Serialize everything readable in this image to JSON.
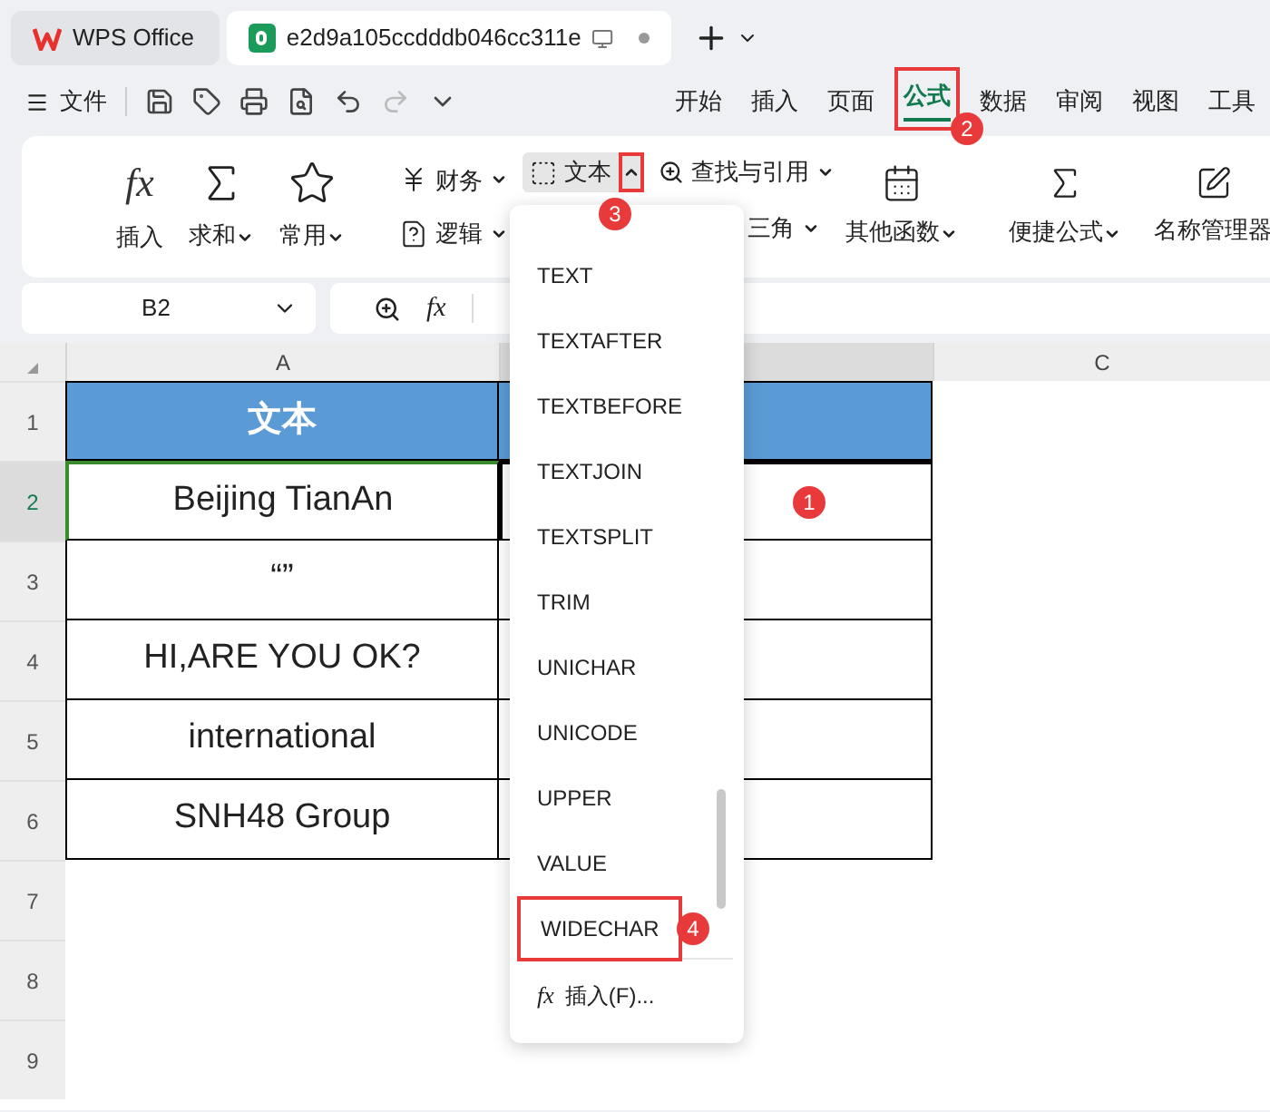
{
  "title_tabs": [
    {
      "label": "WPS Office",
      "kind": "home",
      "selected": false
    },
    {
      "label": "e2d9a105ccdddb046cc311e",
      "kind": "doc",
      "selected": true
    }
  ],
  "menu": {
    "file": "文件",
    "tabs": [
      {
        "label": "开始",
        "selected": false
      },
      {
        "label": "插入",
        "selected": false
      },
      {
        "label": "页面",
        "selected": false
      },
      {
        "label": "公式",
        "selected": true,
        "badge": "2"
      },
      {
        "label": "数据",
        "selected": false
      },
      {
        "label": "审阅",
        "selected": false
      },
      {
        "label": "视图",
        "selected": false
      },
      {
        "label": "工具",
        "selected": false
      }
    ]
  },
  "ribbon": {
    "big": [
      {
        "label": "插入",
        "glyph": "fx",
        "caret": false
      },
      {
        "label": "求和",
        "caret": true
      },
      {
        "label": "常用",
        "caret": true
      }
    ],
    "col1": [
      {
        "label": "财务",
        "selected": false
      },
      {
        "label": "逻辑",
        "selected": false
      }
    ],
    "text_button": {
      "label": "文本",
      "selected": true,
      "badge": "3"
    },
    "lookup": "查找与引用",
    "trig": "三角",
    "other": {
      "label": "其他函数"
    },
    "quick": {
      "label": "便捷公式"
    },
    "names": {
      "label": "名称管理器"
    }
  },
  "formula_bar": {
    "cell_ref": "B2",
    "glyph": "fx"
  },
  "sheet": {
    "columns": [
      {
        "label": "A",
        "selected": false
      },
      {
        "selected": true
      },
      {
        "label": "C",
        "selected": false
      }
    ],
    "header": "文本",
    "rows": [
      {
        "label": "1",
        "selected": false
      },
      {
        "label": "2",
        "selected": true
      },
      {
        "label": "3",
        "selected": false
      },
      {
        "label": "4",
        "selected": false
      },
      {
        "label": "5",
        "selected": false
      },
      {
        "label": "6",
        "selected": false
      },
      {
        "label": "7",
        "selected": false
      },
      {
        "label": "8",
        "selected": false
      },
      {
        "label": "9",
        "selected": false
      }
    ],
    "cells": [
      "Beijing TianAn",
      "“”",
      "HI,ARE YOU OK?",
      "international",
      "SNH48 Group"
    ],
    "selected_badge": "1"
  },
  "dropdown": {
    "items": [
      {
        "label": "TEXT",
        "selected": false
      },
      {
        "label": "TEXTAFTER",
        "selected": false
      },
      {
        "label": "TEXTBEFORE",
        "selected": false
      },
      {
        "label": "TEXTJOIN",
        "selected": false
      },
      {
        "label": "TEXTSPLIT",
        "selected": false
      },
      {
        "label": "TRIM",
        "selected": false
      },
      {
        "label": "UNICHAR",
        "selected": false
      },
      {
        "label": "UNICODE",
        "selected": false
      },
      {
        "label": "UPPER",
        "selected": false
      },
      {
        "label": "VALUE",
        "selected": false
      },
      {
        "label": "WIDECHAR",
        "selected": true,
        "badge": "4"
      }
    ],
    "footer_glyph": "fx",
    "footer": "插入(F)..."
  }
}
